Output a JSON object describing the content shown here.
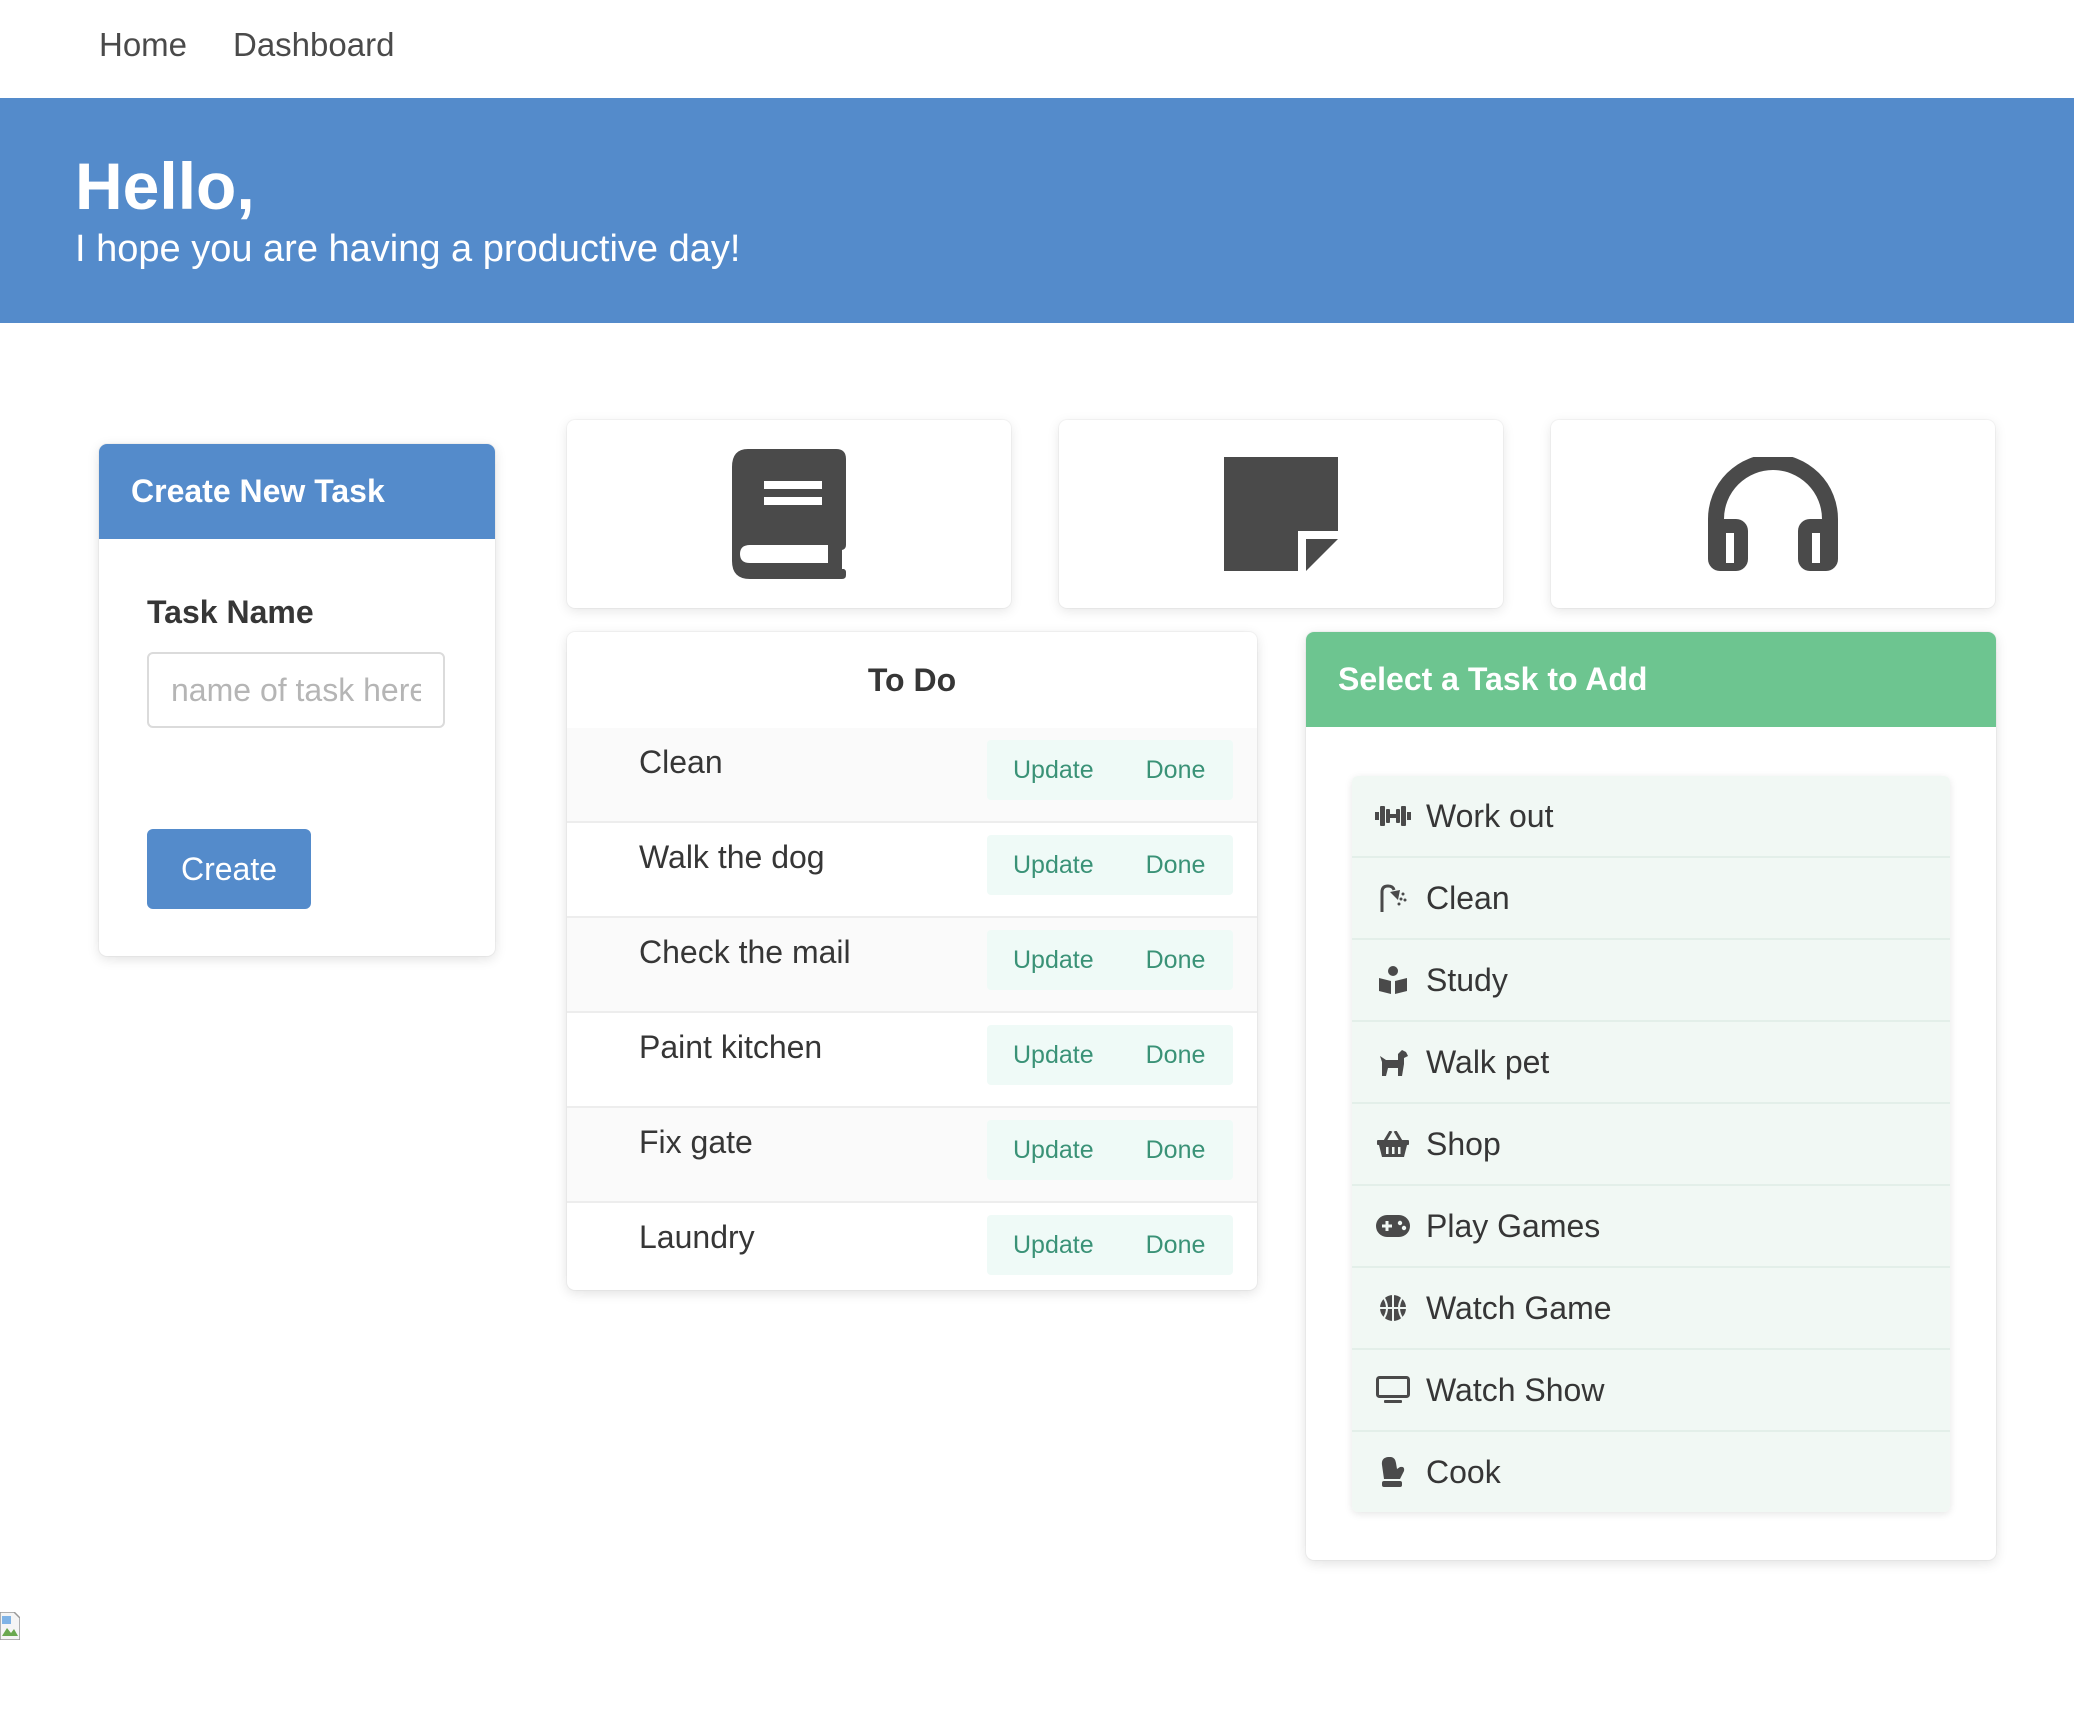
{
  "nav": {
    "home": "Home",
    "dashboard": "Dashboard"
  },
  "hero": {
    "title": "Hello,",
    "subtitle": "I hope you are having a productive day!"
  },
  "create_task": {
    "header": "Create New Task",
    "field_label": "Task Name",
    "placeholder": "name of task here",
    "value": "",
    "button": "Create"
  },
  "tiles": [
    {
      "icon": "book-icon"
    },
    {
      "icon": "sticky-note-icon"
    },
    {
      "icon": "headphones-icon"
    }
  ],
  "todo": {
    "title": "To Do",
    "update_label": "Update",
    "done_label": "Done",
    "items": [
      {
        "name": "Clean"
      },
      {
        "name": "Walk the dog"
      },
      {
        "name": "Check the mail"
      },
      {
        "name": "Paint kitchen"
      },
      {
        "name": "Fix gate"
      },
      {
        "name": "Laundry"
      }
    ]
  },
  "select": {
    "header": "Select a Task to Add",
    "items": [
      {
        "label": "Work out",
        "icon": "dumbbell-icon"
      },
      {
        "label": "Clean",
        "icon": "shower-icon"
      },
      {
        "label": "Study",
        "icon": "book-reader-icon"
      },
      {
        "label": "Walk pet",
        "icon": "dog-icon"
      },
      {
        "label": "Shop",
        "icon": "shopping-basket-icon"
      },
      {
        "label": "Play Games",
        "icon": "gamepad-icon"
      },
      {
        "label": "Watch Game",
        "icon": "basketball-icon"
      },
      {
        "label": "Watch Show",
        "icon": "tv-icon"
      },
      {
        "label": "Cook",
        "icon": "mitten-icon"
      }
    ]
  },
  "colors": {
    "primary": "#548bcb",
    "success": "#6dc590",
    "action_text": "#3a9277",
    "action_bg": "#effaf7",
    "icon": "#4a4a4a"
  }
}
